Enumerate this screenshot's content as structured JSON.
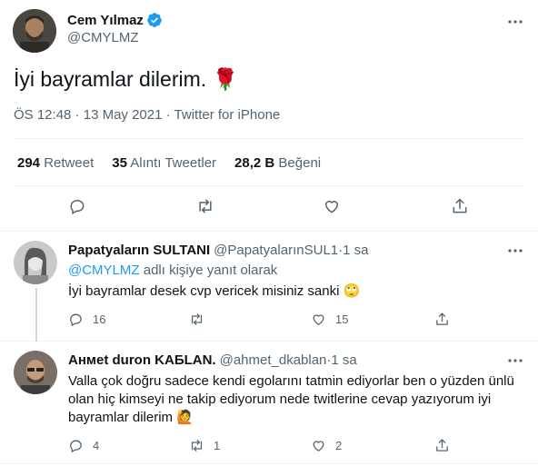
{
  "main_tweet": {
    "author_name": "Cem Yılmaz",
    "author_handle": "@CMYLMZ",
    "text": "İyi bayramlar dilerim.",
    "emoji": "🌹",
    "time": "ÖS 12:48",
    "date": "13 May 2021",
    "source": "Twitter for iPhone",
    "meta_separator": " · ",
    "stats": {
      "retweets_count": "294",
      "retweets_label": "Retweet",
      "quotes_count": "35",
      "quotes_label": "Alıntı Tweetler",
      "likes_count": "28,2 B",
      "likes_label": "Beğeni"
    }
  },
  "replies": [
    {
      "author_name": "Papatyaların SULTANI",
      "author_handle": "@PapatyalarınSUL1",
      "time": "1 sa",
      "reply_to_handle": "@CMYLMZ",
      "reply_to_suffix": " adlı kişiye yanıt olarak",
      "text": "İyi bayramlar desek cvp vericek misiniz sanki 🙄",
      "reply_count": "16",
      "retweet_count": "",
      "like_count": "15"
    },
    {
      "author_name": "Aнмet duron KAБLAN.",
      "author_handle": "@ahmet_dkablan",
      "time": "1 sa",
      "text": "Valla çok doğru sadece kendi egolarını tatmin ediyorlar ben o yüzden ünlü olan hiç kimseyi ne takip ediyorum nede twitlerine cevap yazıyorum iyi bayramlar dilerim 🙋",
      "reply_count": "4",
      "retweet_count": "1",
      "like_count": "2"
    }
  ],
  "colors": {
    "accent": "#1d9bf0",
    "text_primary": "#0f1419",
    "text_secondary": "#536471",
    "divider": "#eff3f4"
  },
  "icons": [
    "verified-badge-icon",
    "more-icon",
    "reply-icon",
    "retweet-icon",
    "like-icon",
    "share-icon"
  ]
}
